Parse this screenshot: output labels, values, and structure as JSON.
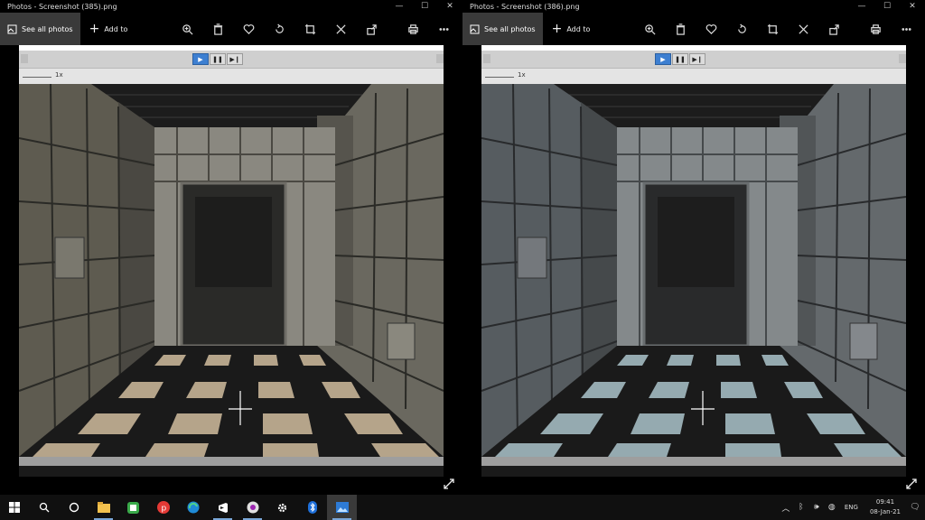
{
  "windows": [
    {
      "title": "Photos - Screenshot (385).png",
      "toolbar": {
        "see_all": "See all photos",
        "add_to": "Add to"
      },
      "player": {
        "speed_label": "1x"
      }
    },
    {
      "title": "Photos - Screenshot (386).png",
      "toolbar": {
        "see_all": "See all photos",
        "add_to": "Add to"
      },
      "player": {
        "speed_label": "1x"
      }
    }
  ],
  "taskbar": {
    "apps": [
      "start-icon",
      "search-icon",
      "cortana-icon",
      "file-explorer-icon",
      "green-app-icon",
      "red-p-app-icon",
      "edge-icon",
      "visual-studio-icon",
      "media-app-icon",
      "settings-icon",
      "bluetooth-icon",
      "photos-icon"
    ],
    "language": "ENG",
    "time": "09:41",
    "date": "08-Jan-21"
  },
  "colors": {
    "player_active": "#3d7fd1",
    "taskbar_bg": "#101010",
    "toolbar_active": "#3a3a3a"
  }
}
